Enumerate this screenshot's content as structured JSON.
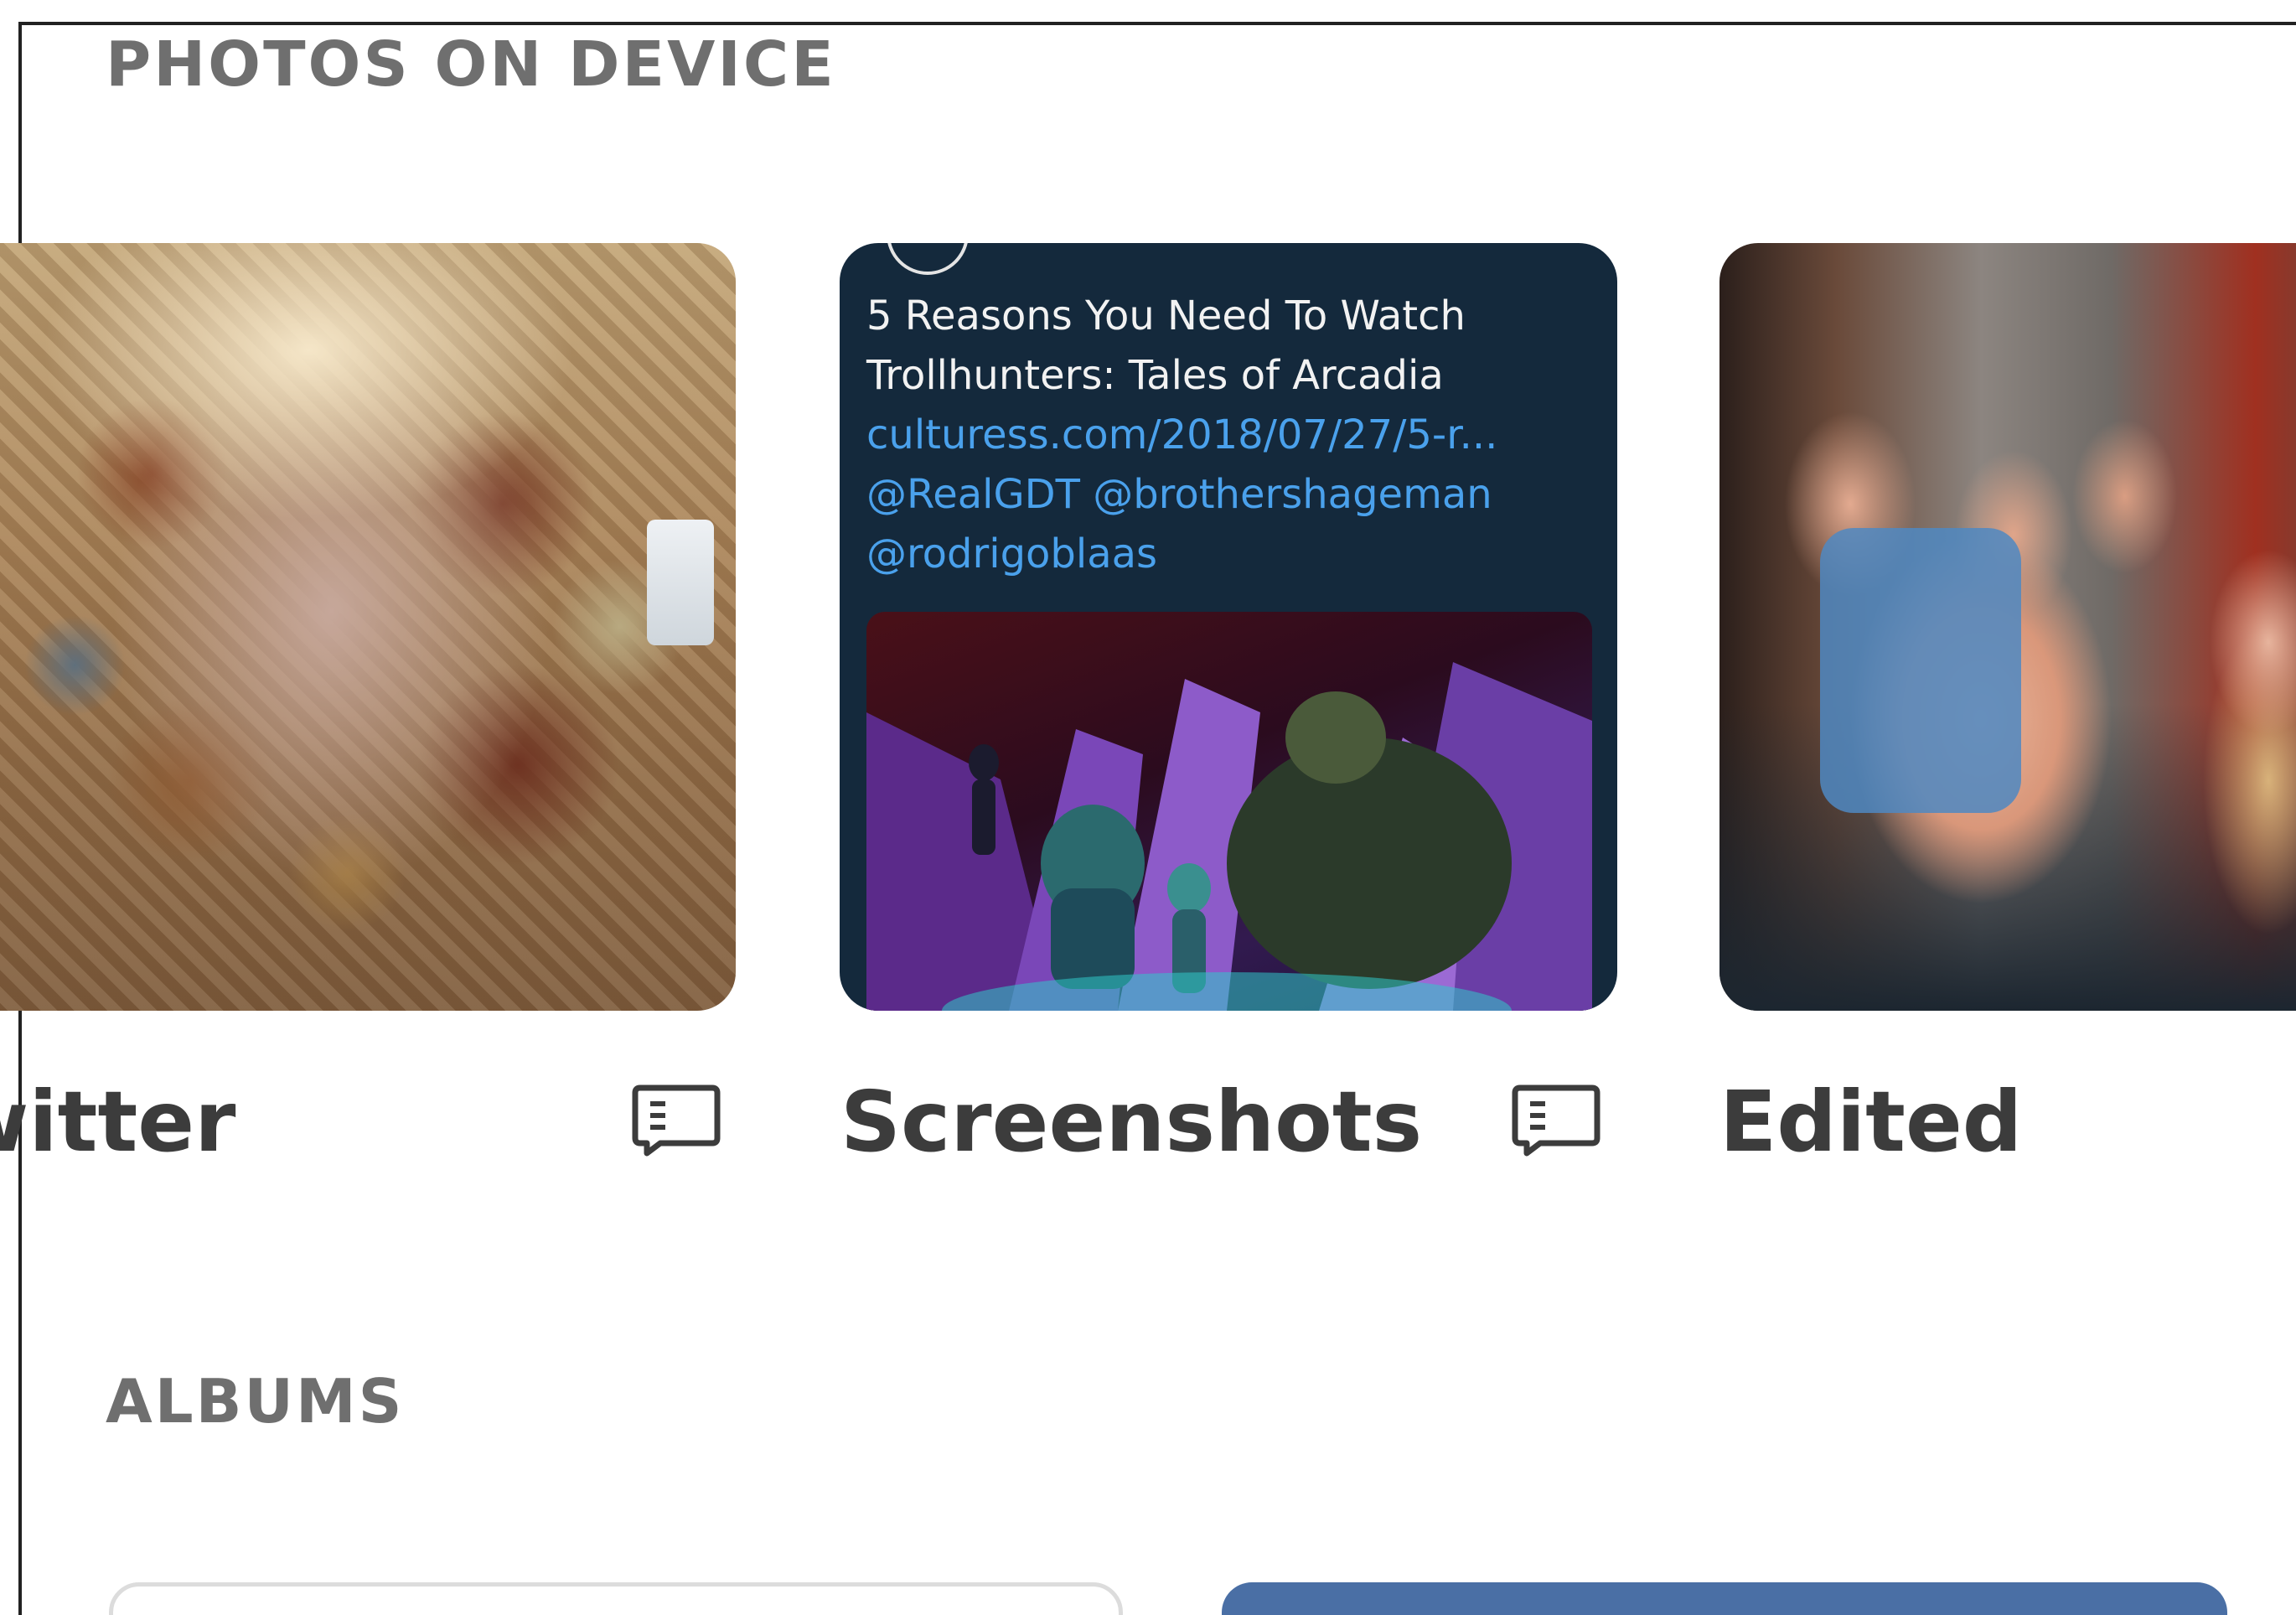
{
  "sections": {
    "photos_on_device": "PHOTOS ON DEVICE",
    "albums": "ALBUMS"
  },
  "device_folders": [
    {
      "label": "witter",
      "thumbnail": "baroque ceiling fresco",
      "icon": "card-label-icon"
    },
    {
      "label": "Screenshots",
      "icon": "card-label-icon",
      "tweet": {
        "text": "5 Reasons You Need To Watch Trollhunters: Tales of Arcadia",
        "link": "culturess.com/2018/07/27/5-r...",
        "mentions_line1": "@RealGDT @brothershageman",
        "mentions_line2": "@rodrigoblaas"
      }
    },
    {
      "label": "Edited",
      "thumbnail": "group selfie"
    }
  ],
  "colors": {
    "heading": "#6f6f6f",
    "label": "#3c3c3c",
    "tweet_bg": "#14293c",
    "tweet_link": "#4aa1ec"
  }
}
